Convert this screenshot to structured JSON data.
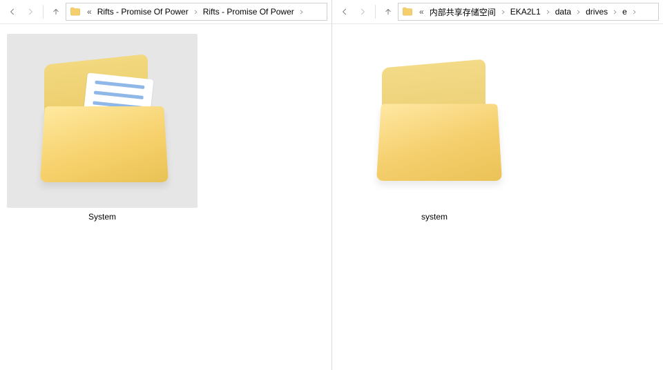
{
  "left": {
    "breadcrumb_prefix": "«",
    "crumbs": [
      "Rifts - Promise Of Power",
      "Rifts - Promise Of Power"
    ],
    "items": [
      {
        "name": "System",
        "selected": true,
        "variant": "docs"
      }
    ]
  },
  "right": {
    "breadcrumb_prefix": "«",
    "crumbs": [
      "内部共享存储空间",
      "EKA2L1",
      "data",
      "drives",
      "e"
    ],
    "items": [
      {
        "name": "system",
        "selected": false,
        "variant": "empty"
      }
    ]
  }
}
